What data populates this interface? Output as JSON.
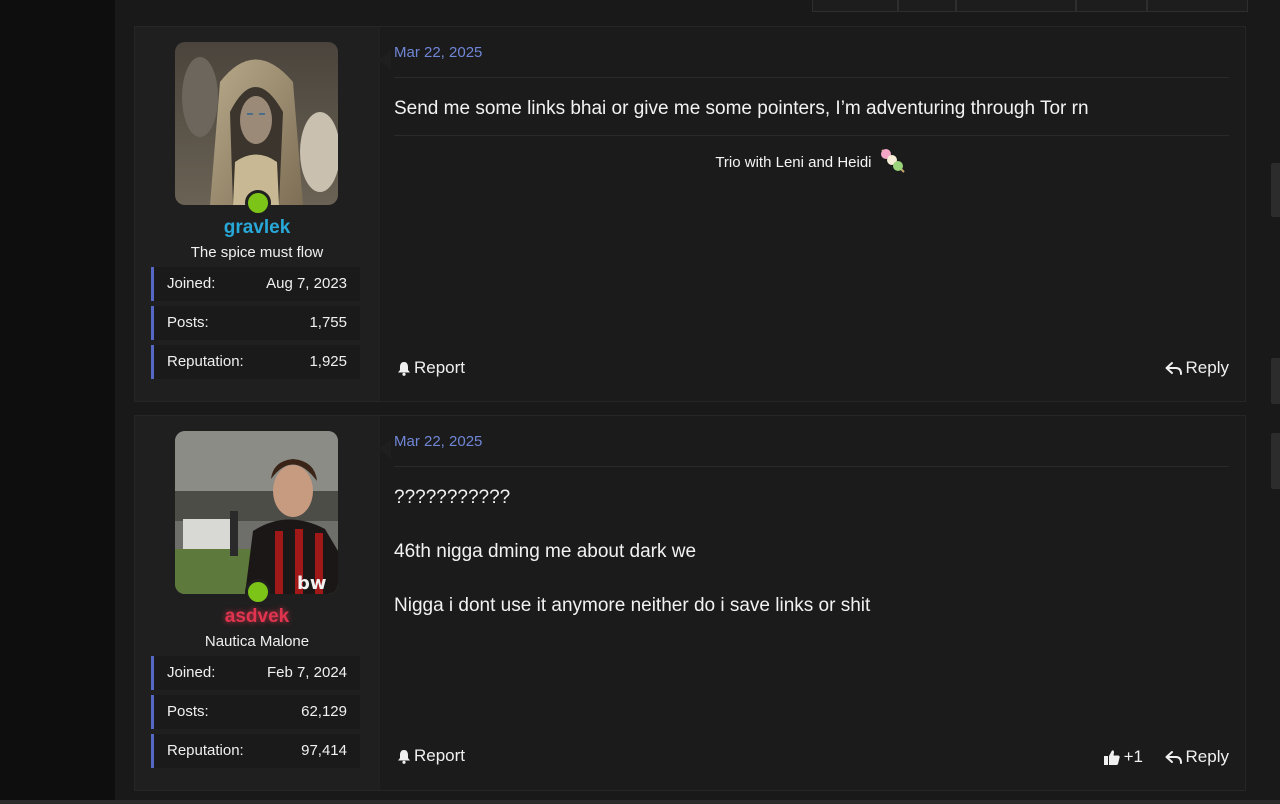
{
  "posts": [
    {
      "username": "gravlek",
      "username_color": "#28a8d8",
      "user_title": "The spice must flow",
      "stats": [
        {
          "label": "Joined:",
          "value": "Aug 7, 2023"
        },
        {
          "label": "Posts:",
          "value": "1,755"
        },
        {
          "label": "Reputation:",
          "value": "1,925"
        }
      ],
      "date": "Mar 22, 2025",
      "message_lines": [
        "Send me some links bhai or give me some pointers, I’m adventuring through Tor rn"
      ],
      "signature": "Trio with Leni and Heidi",
      "report_label": "Report",
      "reply_label": "Reply"
    },
    {
      "username": "asdvek",
      "username_color": "#e0344f",
      "user_title": "Nautica Malone",
      "stats": [
        {
          "label": "Joined:",
          "value": "Feb 7, 2024"
        },
        {
          "label": "Posts:",
          "value": "62,129"
        },
        {
          "label": "Reputation:",
          "value": "97,414"
        }
      ],
      "date": "Mar 22, 2025",
      "message_lines": [
        "???????????",
        "46th nigga dming me about dark we",
        "Nigga i dont use it anymore neither do i save links or shit"
      ],
      "report_label": "Report",
      "like_count": "+1",
      "reply_label": "Reply"
    }
  ]
}
